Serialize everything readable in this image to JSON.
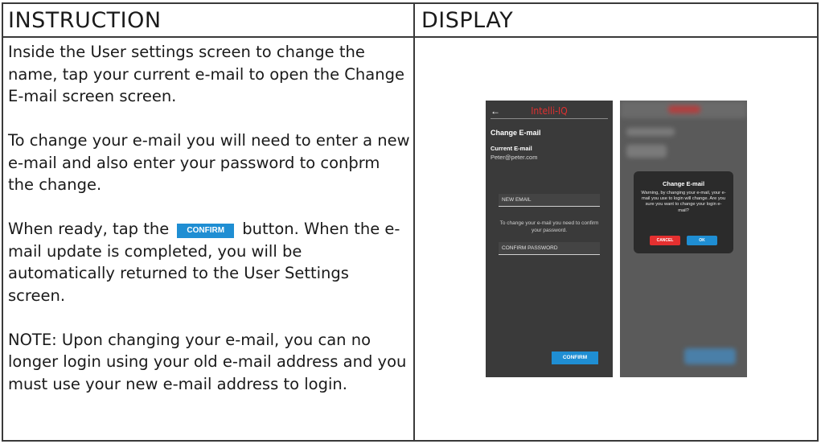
{
  "headers": {
    "instruction": "INSTRUCTION",
    "display": "DISPLAY"
  },
  "instruction": {
    "p1": "Inside the User settings screen to change the name, tap your current e-mail to open the Change E-mail screen screen.",
    "p2": "To change your e-mail you will need to enter a new e-mail and also enter your password to conþrm the change.",
    "p3_before": "When ready, tap the",
    "p3_button": "CONFIRM",
    "p3_after": "button. When the e-mail update is completed, you will be automatically returned to the User Settings screen.",
    "p4": "NOTE: Upon changing your e-mail, you can no longer login using your old e-mail address and you must use your new e-mail address to login."
  },
  "phone1": {
    "back_icon": "left-arrow-icon",
    "logo": "Intelli-IQ",
    "title": "Change E-mail",
    "current_label": "Current E-mail",
    "current_value": "Peter@peter.com",
    "new_email_placeholder": "NEW EMAIL",
    "note": "To change your e-mail you need to confirm your password.",
    "confirm_password_placeholder": "CONFIRM PASSWORD",
    "confirm_button": "CONFIRM"
  },
  "phone2": {
    "dialog_title": "Change E-mail",
    "dialog_text": "Warning, by changing your e-mail, your e-mail you use to login will change. Are you sure you want to change your login e-mail?",
    "cancel": "CANCEL",
    "ok": "OK"
  },
  "colors": {
    "accent": "#1f8ed3",
    "logo": "#e03030",
    "cancel": "#e53030",
    "phone_bg": "#3a3a3a"
  }
}
